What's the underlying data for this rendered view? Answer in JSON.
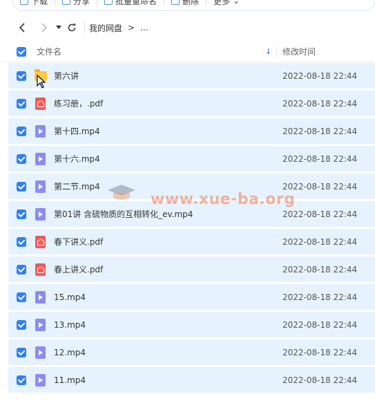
{
  "toolbar": {
    "items": [
      {
        "label": "下载",
        "icon": "download-icon"
      },
      {
        "label": "分享",
        "icon": "share-icon"
      },
      {
        "label": "批量重命名",
        "icon": "rename-icon"
      },
      {
        "label": "删除",
        "icon": "delete-icon"
      },
      {
        "label": "更多",
        "icon": "more-icon"
      }
    ]
  },
  "nav": {
    "back_icon": "chevron-left-icon",
    "forward_icon": "chevron-right-icon",
    "history_icon": "caret-down-icon",
    "refresh_icon": "refresh-icon",
    "breadcrumb": {
      "root": "我的网盘",
      "sep": ">",
      "tail": "..."
    }
  },
  "header": {
    "name": "文件名",
    "sort": "↓",
    "time": "修改时间"
  },
  "files": [
    {
      "name": "第六讲",
      "type": "folder",
      "time": "2022-08-18 22:44"
    },
    {
      "name": "练习册，.pdf",
      "type": "pdf",
      "time": "2022-08-18 22:44"
    },
    {
      "name": "第十四.mp4",
      "type": "video",
      "time": "2022-08-18 22:44"
    },
    {
      "name": "第十六.mp4",
      "type": "video",
      "time": "2022-08-18 22:44"
    },
    {
      "name": "第二节.mp4",
      "type": "video",
      "time": "2022-08-18 22:44"
    },
    {
      "name": "第01讲 含硫物质的互相转化_ev.mp4",
      "type": "video",
      "time": "2022-08-18 22:44"
    },
    {
      "name": "春下讲义.pdf",
      "type": "pdf",
      "time": "2022-08-18 22:44"
    },
    {
      "name": "春上讲义.pdf",
      "type": "pdf",
      "time": "2022-08-18 22:44"
    },
    {
      "name": "15.mp4",
      "type": "video",
      "time": "2022-08-18 22:44"
    },
    {
      "name": "13.mp4",
      "type": "video",
      "time": "2022-08-18 22:44"
    },
    {
      "name": "12.mp4",
      "type": "video",
      "time": "2022-08-18 22:44"
    },
    {
      "name": "11.mp4",
      "type": "video",
      "time": "2022-08-18 22:44"
    }
  ],
  "watermark": "www.xue-ba.org",
  "colors": {
    "accent": "#2f7ff7",
    "row_selected": "#e6f3fe",
    "pdf": "#f25a5a",
    "video": "#8c8cf0",
    "folder": "#ffc940"
  }
}
